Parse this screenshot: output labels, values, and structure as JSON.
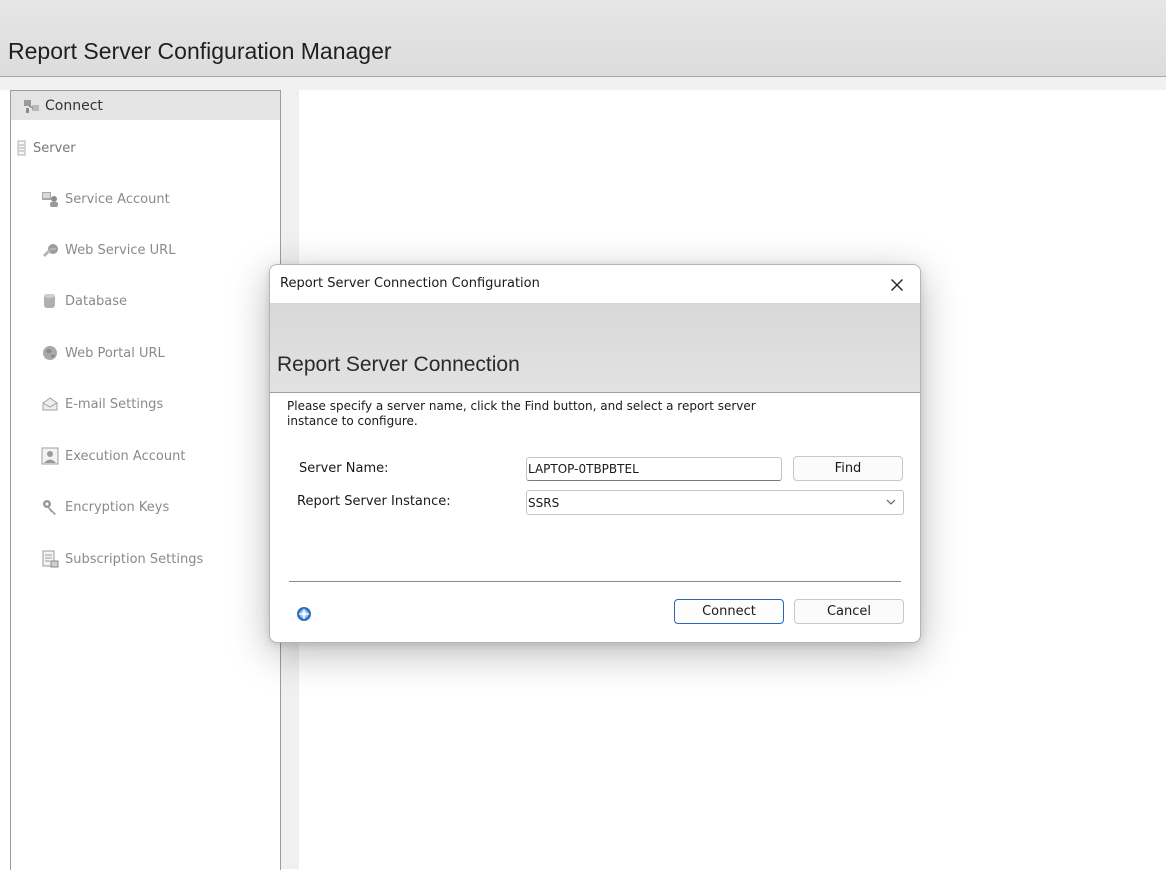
{
  "app": {
    "title": "Report Server Configuration Manager"
  },
  "sidebar": {
    "connect": {
      "label": "Connect",
      "icon": "connect-icon"
    },
    "server": {
      "label": "Server",
      "icon": "server-icon"
    },
    "items": [
      {
        "label": "Service Account",
        "icon": "service-account-icon"
      },
      {
        "label": "Web Service URL",
        "icon": "web-service-url-icon"
      },
      {
        "label": "Database",
        "icon": "database-icon"
      },
      {
        "label": "Web Portal URL",
        "icon": "globe-icon"
      },
      {
        "label": "E-mail Settings",
        "icon": "email-icon"
      },
      {
        "label": "Execution Account",
        "icon": "execution-account-icon"
      },
      {
        "label": "Encryption Keys",
        "icon": "key-icon"
      },
      {
        "label": "Subscription Settings",
        "icon": "subscription-icon"
      }
    ]
  },
  "dialog": {
    "title": "Report Server Connection Configuration",
    "heading": "Report Server Connection",
    "instructions": "Please specify a server name, click the Find button, and select a report server instance to configure.",
    "server_name_label": "Server Name:",
    "server_name_value": "LAPTOP-0TBPBTEL",
    "instance_label": "Report Server Instance:",
    "instance_value": "SSRS",
    "find_label": "Find",
    "connect_label": "Connect",
    "cancel_label": "Cancel"
  },
  "colors": {
    "header_bg": "#e0e0e0",
    "primary_button_border": "#2b67b8"
  }
}
